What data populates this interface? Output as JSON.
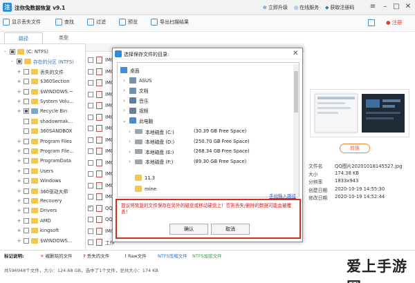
{
  "window": {
    "title": "注你兔数据恢复 v9.1"
  },
  "titlebar_links": [
    "立即升级",
    "在线服务",
    "获取注册码"
  ],
  "toolbar": {
    "items": [
      "显示丢失文件",
      "查找",
      "过滤",
      "预览",
      "导出扫描结果"
    ],
    "register": "注册"
  },
  "tabs": [
    "路径",
    "类型"
  ],
  "tree": [
    {
      "label": "(C: NTFS)",
      "level": 0,
      "check": "half",
      "expand": "-"
    },
    {
      "label": "存在的分区 (NTFS)",
      "level": 1,
      "check": "half",
      "expand": "-",
      "color": "#2e6fbf"
    },
    {
      "label": "丢失的文件",
      "level": 2,
      "check": "off",
      "expand": "+"
    },
    {
      "label": "$360Section",
      "level": 2,
      "check": "off",
      "expand": "+"
    },
    {
      "label": "$WINDOWS.~",
      "level": 2,
      "check": "off",
      "expand": "+"
    },
    {
      "label": "System Volu...",
      "level": 2,
      "check": "off",
      "expand": "+"
    },
    {
      "label": "Recycle Bin",
      "level": 2,
      "check": "half",
      "expand": "+",
      "bin": true
    },
    {
      "label": "shadowmak...",
      "level": 2,
      "check": "off",
      "expand": ""
    },
    {
      "label": "360SANDBOX",
      "level": 2,
      "check": "off",
      "expand": ""
    },
    {
      "label": "Program Files",
      "level": 2,
      "check": "off",
      "expand": "+"
    },
    {
      "label": "Program File...",
      "level": 2,
      "check": "off",
      "expand": "+"
    },
    {
      "label": "ProgramData",
      "level": 2,
      "check": "off",
      "expand": "+"
    },
    {
      "label": "Users",
      "level": 2,
      "check": "off",
      "expand": "+"
    },
    {
      "label": "Windows",
      "level": 2,
      "check": "off",
      "expand": "+"
    },
    {
      "label": "360驱动大师",
      "level": 2,
      "check": "off",
      "expand": "+"
    },
    {
      "label": "Recovery",
      "level": 2,
      "check": "off",
      "expand": "+"
    },
    {
      "label": "Drivers",
      "level": 2,
      "check": "off",
      "expand": "+"
    },
    {
      "label": "AMD",
      "level": 2,
      "check": "off",
      "expand": "+"
    },
    {
      "label": "kingsoft",
      "level": 2,
      "check": "off",
      "expand": "+"
    },
    {
      "label": "$WINDOWS...",
      "level": 2,
      "check": "off",
      "expand": "+"
    }
  ],
  "list": [
    {
      "name": "IMG",
      "check": false
    },
    {
      "name": "IMG",
      "check": false
    },
    {
      "name": "IMG",
      "check": false
    },
    {
      "name": "IMG",
      "check": false
    },
    {
      "name": "IMG",
      "check": false
    },
    {
      "name": "IMG",
      "check": false
    },
    {
      "name": "IMG",
      "check": false
    },
    {
      "name": "IMG",
      "check": false
    },
    {
      "name": "IMG",
      "check": false
    },
    {
      "name": "IMG",
      "check": false
    },
    {
      "name": "IMG",
      "check": false
    },
    {
      "name": "IMG",
      "check": false
    },
    {
      "name": "IMG",
      "check": false
    },
    {
      "name": "QQE",
      "check": true
    },
    {
      "name": "QQE",
      "check": false
    },
    {
      "name": "IMG",
      "check": false
    },
    {
      "name": "工作",
      "check": false
    }
  ],
  "preview": {
    "button": "转换",
    "info": [
      {
        "k": "文件名",
        "v": "QQ图片20201018145527.jpg"
      },
      {
        "k": "大小",
        "v": "174.38 KB"
      },
      {
        "k": "分辨率",
        "v": "1833x943"
      },
      {
        "k": "创建日期",
        "v": "2020-10-19 14:55:30"
      },
      {
        "k": "修改日期",
        "v": "2020-10-19 14:52:44"
      }
    ]
  },
  "legend": {
    "title": "标记说明:",
    "items": [
      {
        "mark": "✕",
        "text": "被删除的文件",
        "color": "#d33"
      },
      {
        "mark": "?",
        "text": "丢失的文件",
        "color": "#d33"
      },
      {
        "mark": "!",
        "text": "Raw文件",
        "color": "#d33"
      },
      {
        "mark": "",
        "text": "NTFS压缩文件",
        "color": "#2e6fbf"
      },
      {
        "mark": "",
        "text": "NTFS加密文件",
        "color": "#2e9f3e"
      }
    ]
  },
  "status": "共596948个文件，大小：124.68 GB，选中了1个文件，总共大小：174 KB",
  "dialog": {
    "title": "选择保存文件的目录:",
    "root": "桌面",
    "items": [
      {
        "label": "ASUS",
        "type": "user"
      },
      {
        "label": "文档",
        "type": "doc"
      },
      {
        "label": "音乐",
        "type": "music"
      },
      {
        "label": "视频",
        "type": "video"
      },
      {
        "label": "此电脑",
        "type": "pc"
      }
    ],
    "drives": [
      {
        "label": "本地磁盘 (C:)",
        "space": "(30.39 GB Free Space)"
      },
      {
        "label": "本地磁盘 (D:)",
        "space": "(250.70 GB Free Space)"
      },
      {
        "label": "本地磁盘 (E:)",
        "space": "(268.34 GB Free Space)"
      },
      {
        "label": "本地磁盘 (F:)",
        "space": "(89.30 GB Free Space)"
      }
    ],
    "folders": [
      "11.3",
      "mine"
    ],
    "manual_link": "手动输入路径",
    "warning": "提议将恢复的文件保存在另外的磁盘或移动硬盘上！否则丢失/删除的数据可能会被覆盖！",
    "ok": "确认",
    "cancel": "取消"
  },
  "watermark": {
    "text": "爱上手游网"
  },
  "colors": {
    "accent": "#2e6fbf",
    "warning": "#d92a1c",
    "orange": "#e8893a"
  }
}
